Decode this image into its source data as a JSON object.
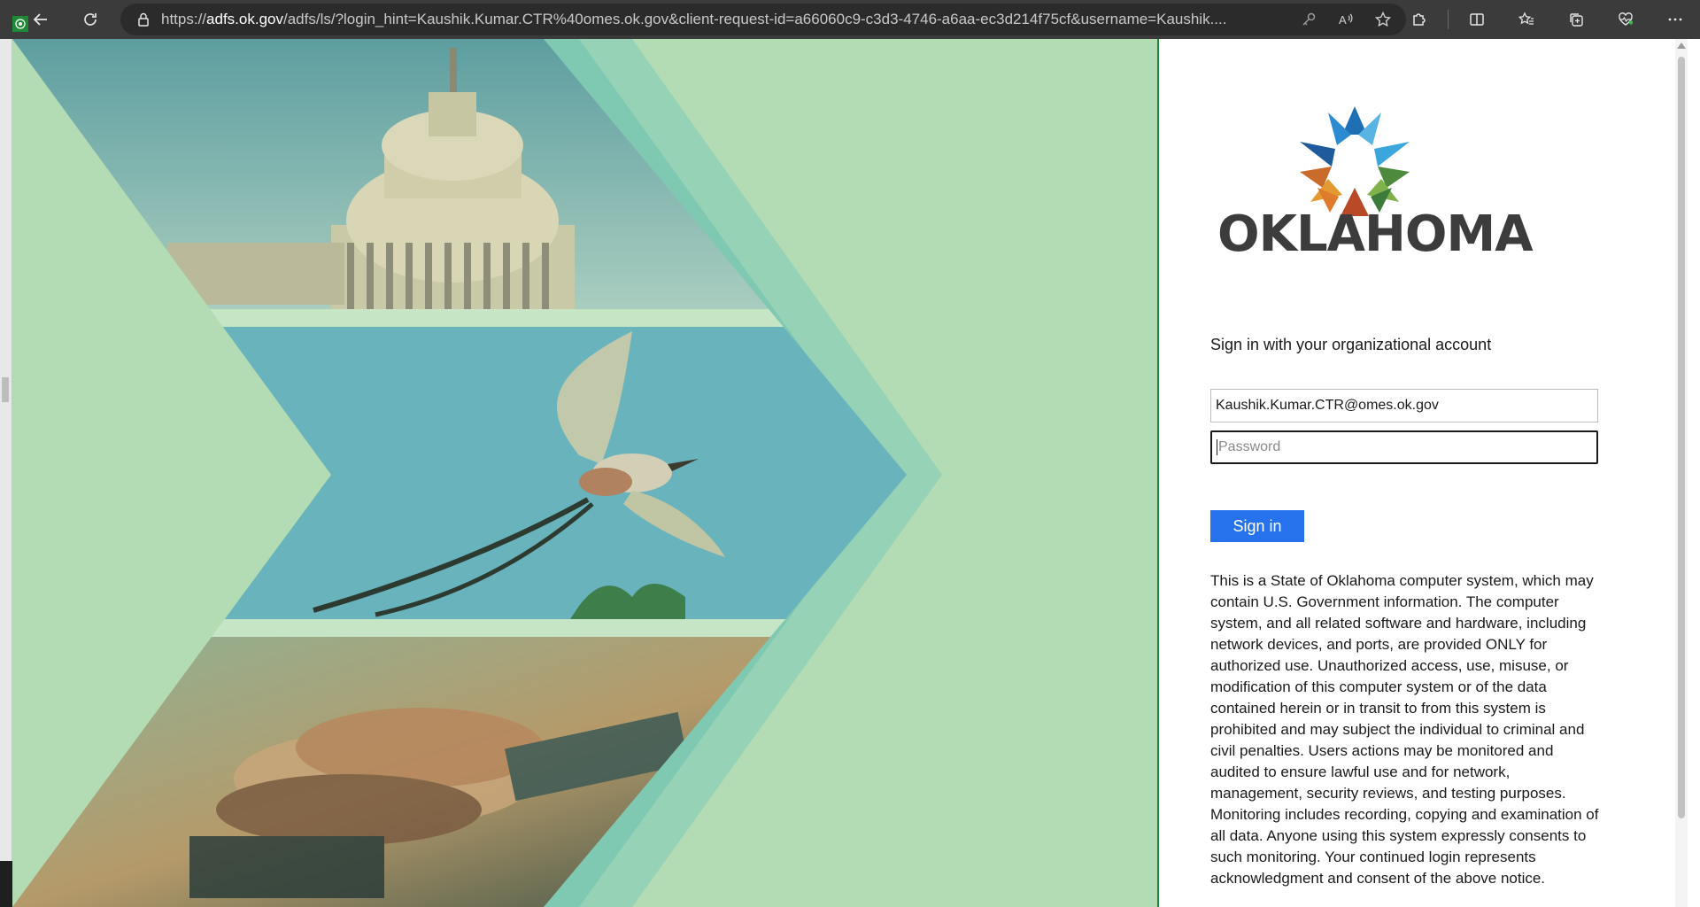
{
  "browser": {
    "url_prefix": "https://",
    "url_host": "adfs.ok.gov",
    "url_rest": "/adfs/ls/?login_hint=Kaushik.Kumar.CTR%40omes.ok.gov&client-request-id=a66060c9-c3d3-4746-a6aa-ec3d214f75cf&username=Kaushik...."
  },
  "logo": {
    "text": "OKLAHOMA"
  },
  "form": {
    "title": "Sign in with your organizational account",
    "username_value": "Kaushik.Kumar.CTR@omes.ok.gov",
    "password_placeholder": "Password",
    "submit_label": "Sign in"
  },
  "notice": "This is a State of Oklahoma computer system, which may contain U.S. Government information. The computer system, and all related software and hardware, including network devices, and ports, are provided ONLY for authorized use. Unauthorized access, use, misuse, or modification of this computer system or of the data contained herein or in transit to from this system is prohibited and may subject the individual to criminal and civil penalties. Users actions may be monitored and audited to ensure lawful use and for network, management, security reviews, and testing purposes. Monitoring includes recording, copying and examination of all data. Anyone using this system expressly consents to such monitoring. Your continued login represents acknowledgment and consent of the above notice.",
  "colors": {
    "hero_bg": "#b3dcb5",
    "submit_bg": "#2672ec",
    "browser_chrome": "#3b3b3b"
  }
}
